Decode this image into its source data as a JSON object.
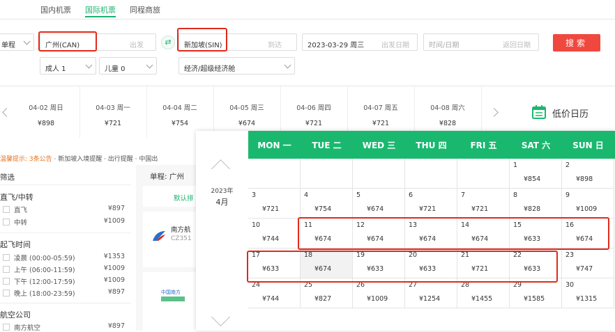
{
  "tabs": [
    "国内机票",
    "国际机票",
    "同程商旅"
  ],
  "search": {
    "trip_type": "单程",
    "from_value": "广州(CAN)",
    "from_placeholder": "出发",
    "to_value": "新加坡(SIN)",
    "to_placeholder": "到达",
    "depart_value": "2023-03-29 周三",
    "depart_placeholder": "出发日期",
    "return_value": "时间/日期",
    "return_placeholder": "返回日期",
    "adults": "成人 1",
    "children": "儿童 0",
    "cabin": "经济/超级经济舱",
    "search_label": "搜索",
    "swap_icon": "swap-icon"
  },
  "date_strip": [
    {
      "date": "04-02 周日",
      "price": "¥898"
    },
    {
      "date": "04-03 周一",
      "price": "¥721"
    },
    {
      "date": "04-04 周二",
      "price": "¥754"
    },
    {
      "date": "04-05 周三",
      "price": "¥674"
    },
    {
      "date": "04-06 周四",
      "price": "¥721"
    },
    {
      "date": "04-07 周五",
      "price": "¥721"
    },
    {
      "date": "04-08 周六",
      "price": "¥828"
    }
  ],
  "low_price_calendar_label": "低价日历",
  "notice": {
    "prefix": "温馨提示: 3条公告",
    "items": "· 新加坡入境提醒 · 出行提醒 · 中国出"
  },
  "filter": {
    "title": "筛选",
    "sections": [
      {
        "title": "直飞/中转",
        "options": [
          {
            "label": "直飞",
            "price": "¥897"
          },
          {
            "label": "中转",
            "price": "¥1009"
          }
        ]
      },
      {
        "title": "起飞时间",
        "options": [
          {
            "label": "凌晨 (00:00-05:59)",
            "price": "¥1353"
          },
          {
            "label": "上午 (06:00-11:59)",
            "price": "¥1009"
          },
          {
            "label": "下午 (12:00-17:59)",
            "price": "¥1009"
          },
          {
            "label": "晚上 (18:00-23:59)",
            "price": "¥897"
          }
        ]
      },
      {
        "title": "航空公司",
        "options": [
          {
            "label": "南方航空",
            "price": "¥897"
          }
        ]
      }
    ]
  },
  "results": {
    "header": "单程: 广州",
    "sort_label": "默认排",
    "airline1": "南方航",
    "flight1": "CZ351",
    "airline2": "中国南方"
  },
  "calendar": {
    "year": "2023年",
    "month": "4月",
    "weekdays": [
      "MON 一",
      "TUE 二",
      "WED 三",
      "THU 四",
      "FRI 五",
      "SAT 六",
      "SUN 日"
    ],
    "weeks": [
      [
        null,
        null,
        null,
        null,
        null,
        {
          "day": "1",
          "price": "¥854"
        },
        {
          "day": "2",
          "price": "¥898"
        }
      ],
      [
        {
          "day": "3",
          "price": "¥721"
        },
        {
          "day": "4",
          "price": "¥754"
        },
        {
          "day": "5",
          "price": "¥674"
        },
        {
          "day": "6",
          "price": "¥721"
        },
        {
          "day": "7",
          "price": "¥721"
        },
        {
          "day": "8",
          "price": "¥828"
        },
        {
          "day": "9",
          "price": "¥1009"
        }
      ],
      [
        {
          "day": "10",
          "price": "¥744"
        },
        {
          "day": "11",
          "price": "¥674"
        },
        {
          "day": "12",
          "price": "¥674"
        },
        {
          "day": "13",
          "price": "¥674"
        },
        {
          "day": "14",
          "price": "¥674"
        },
        {
          "day": "15",
          "price": "¥633"
        },
        {
          "day": "16",
          "price": "¥674"
        }
      ],
      [
        {
          "day": "17",
          "price": "¥633"
        },
        {
          "day": "18",
          "price": "¥674"
        },
        {
          "day": "19",
          "price": "¥633"
        },
        {
          "day": "20",
          "price": "¥633"
        },
        {
          "day": "21",
          "price": "¥721"
        },
        {
          "day": "22",
          "price": "¥633"
        },
        {
          "day": "23",
          "price": "¥747"
        }
      ],
      [
        {
          "day": "24",
          "price": "¥744"
        },
        {
          "day": "25",
          "price": "¥827"
        },
        {
          "day": "26",
          "price": "¥1009"
        },
        {
          "day": "27",
          "price": "¥1254"
        },
        {
          "day": "28",
          "price": "¥1455"
        },
        {
          "day": "29",
          "price": "¥1585"
        },
        {
          "day": "30",
          "price": "¥1315"
        }
      ]
    ]
  },
  "colors": {
    "accent": "#1ab86f",
    "highlight": "#e02a1b",
    "search_button": "#f0483e",
    "notice": "#e8731b"
  }
}
